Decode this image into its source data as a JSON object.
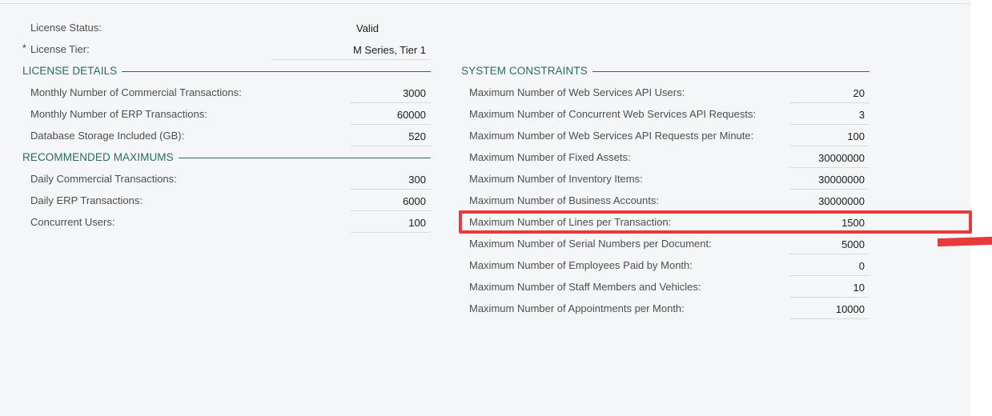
{
  "license_status": {
    "label": "License Status:",
    "value": "Valid"
  },
  "license_tier": {
    "required_mark": "*",
    "label": "License Tier:",
    "value": "M Series, Tier 1"
  },
  "license_details": {
    "title": "LICENSE DETAILS",
    "rows": [
      {
        "label": "Monthly Number of Commercial Transactions:",
        "value": "3000"
      },
      {
        "label": "Monthly Number of ERP Transactions:",
        "value": "60000"
      },
      {
        "label": "Database Storage Included (GB):",
        "value": "520"
      }
    ]
  },
  "recommended_maximums": {
    "title": "RECOMMENDED MAXIMUMS",
    "rows": [
      {
        "label": "Daily Commercial Transactions:",
        "value": "300"
      },
      {
        "label": "Daily ERP Transactions:",
        "value": "6000"
      },
      {
        "label": "Concurrent Users:",
        "value": "100"
      }
    ]
  },
  "system_constraints": {
    "title": "SYSTEM CONSTRAINTS",
    "rows": [
      {
        "label": "Maximum Number of Web Services API Users:",
        "value": "20"
      },
      {
        "label": "Maximum Number of Concurrent Web Services API Requests:",
        "value": "3"
      },
      {
        "label": "Maximum Number of Web Services API Requests per Minute:",
        "value": "100"
      },
      {
        "label": "Maximum Number of Fixed Assets:",
        "value": "30000000"
      },
      {
        "label": "Maximum Number of Inventory Items:",
        "value": "30000000"
      },
      {
        "label": "Maximum Number of Business Accounts:",
        "value": "30000000"
      },
      {
        "label": "Maximum Number of Lines per Transaction:",
        "value": "1500"
      },
      {
        "label": "Maximum Number of Serial Numbers per Document:",
        "value": "5000"
      },
      {
        "label": "Maximum Number of Employees Paid by Month:",
        "value": "0"
      },
      {
        "label": "Maximum Number of Staff Members and Vehicles:",
        "value": "10"
      },
      {
        "label": "Maximum Number of Appointments per Month:",
        "value": "10000"
      }
    ]
  },
  "colors": {
    "section_title": "#2a6b63",
    "highlight": "#e8393b",
    "panel_bg": "#f5f6f7"
  }
}
